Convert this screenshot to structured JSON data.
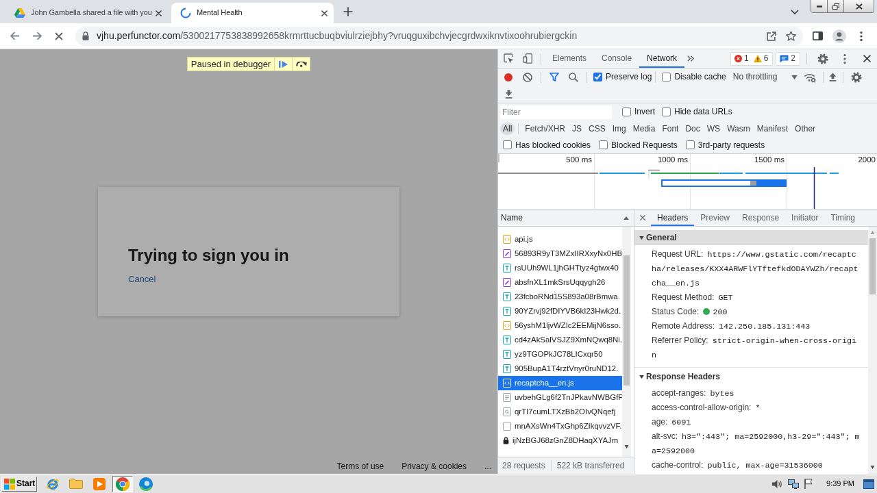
{
  "browser": {
    "tabs": [
      {
        "title": "John Gambella shared a file with you",
        "selected": false,
        "loading": false
      },
      {
        "title": "Mental Health",
        "selected": true,
        "loading": true
      }
    ],
    "address": {
      "host": "vjhu.perfunctor.com",
      "path": "/5300217753838992658krmrttucbuqbviulrziejbhy?vruqguxibchvjecgrdwxiknvtixoohrubiergckin"
    }
  },
  "page": {
    "debugger_banner": "Paused in debugger",
    "card": {
      "title": "Trying to sign you in",
      "link": "Cancel"
    },
    "footer_links": [
      "Terms of use",
      "Privacy & cookies",
      "..."
    ]
  },
  "devtools": {
    "tabs": [
      {
        "label": "Elements",
        "selected": false
      },
      {
        "label": "Console",
        "selected": false
      },
      {
        "label": "Network",
        "selected": true
      }
    ],
    "counts": {
      "errors": "1",
      "warnings": "6",
      "messages": "2"
    },
    "toolbar": {
      "recording": true,
      "checkboxes": [
        {
          "label": "Preserve log",
          "checked": true
        },
        {
          "label": "Disable cache",
          "checked": false
        }
      ],
      "throttling": "No throttling"
    },
    "filter": {
      "placeholder": "Filter",
      "checkboxes": [
        {
          "label": "Invert",
          "checked": false
        },
        {
          "label": "Hide data URLs",
          "checked": false
        }
      ]
    },
    "type_filters": [
      {
        "label": "All",
        "selected": true
      },
      {
        "label": "Fetch/XHR",
        "selected": false
      },
      {
        "label": "JS",
        "selected": false
      },
      {
        "label": "CSS",
        "selected": false
      },
      {
        "label": "Img",
        "selected": false
      },
      {
        "label": "Media",
        "selected": false
      },
      {
        "label": "Font",
        "selected": false
      },
      {
        "label": "Doc",
        "selected": false
      },
      {
        "label": "WS",
        "selected": false
      },
      {
        "label": "Wasm",
        "selected": false
      },
      {
        "label": "Manifest",
        "selected": false
      },
      {
        "label": "Other",
        "selected": false
      }
    ],
    "request_filters": [
      {
        "label": "Has blocked cookies",
        "checked": false
      },
      {
        "label": "Blocked Requests",
        "checked": false
      },
      {
        "label": "3rd-party requests",
        "checked": false
      }
    ],
    "overview": {
      "ticks": [
        "500 ms",
        "1000 ms",
        "1500 ms",
        "2000"
      ]
    },
    "requests": {
      "column": "Name",
      "rows": [
        {
          "name": "api.js",
          "kind": "script",
          "selected": false
        },
        {
          "name": "56893R9yT3MZxIIRXxyNx0HB",
          "kind": "stylesheet",
          "selected": false
        },
        {
          "name": "rsUUh9WL1jhGHTtyz4gtwx40",
          "kind": "font",
          "selected": false
        },
        {
          "name": "absfnXL1mkSrsUqqygh26",
          "kind": "stylesheet",
          "selected": false
        },
        {
          "name": "23fcboRNd15S893a08rBmwa.",
          "kind": "font",
          "selected": false
        },
        {
          "name": "90YZrvj92fDIYVB6kI23Hwk2d.",
          "kind": "font",
          "selected": false
        },
        {
          "name": "56yshM1ljvWZIc2EEMijN6sso.",
          "kind": "script",
          "selected": false
        },
        {
          "name": "cd4zAkSalVSJZ9XmNQwq8Ni.",
          "kind": "font",
          "selected": false
        },
        {
          "name": "yz9TGOPkJC78LICxqr50",
          "kind": "font",
          "selected": false
        },
        {
          "name": "905BupA1T4rztVnyr0ruND12.",
          "kind": "font",
          "selected": false
        },
        {
          "name": "recaptcha__en.js",
          "kind": "script",
          "selected": true
        },
        {
          "name": "uvbehGLg6f2TnJPkavNWBGfP",
          "kind": "document",
          "selected": false
        },
        {
          "name": "qrTI7cumLTXzBb2OIvQNqefj",
          "kind": "image",
          "selected": false
        },
        {
          "name": "mnAXsWn4TxGhp6ZIkqvvzVF.",
          "kind": "blank",
          "selected": false
        },
        {
          "name": "ijNzBGJ68zGnZ8DHaqXYAJm",
          "kind": "lock",
          "selected": false
        }
      ],
      "summary": [
        "28 requests",
        "522 kB transferred"
      ]
    },
    "details": {
      "tabs": [
        {
          "label": "Headers",
          "selected": true
        },
        {
          "label": "Preview",
          "selected": false
        },
        {
          "label": "Response",
          "selected": false
        },
        {
          "label": "Initiator",
          "selected": false
        },
        {
          "label": "Timing",
          "selected": false
        }
      ],
      "sections": [
        {
          "title": "General",
          "expanded": true,
          "selected": true,
          "rows": [
            {
              "name": "Request URL:",
              "value": "https://www.gstatic.com/recaptcha/releases/KXX4ARWFlYTftefkdODAYWZh/recaptcha__en.js"
            },
            {
              "name": "Request Method:",
              "value": "GET"
            },
            {
              "name": "Status Code:",
              "value": "200",
              "color": "#34a853"
            },
            {
              "name": "Remote Address:",
              "value": "142.250.185.131:443"
            },
            {
              "name": "Referrer Policy:",
              "value": "strict-origin-when-cross-origin"
            }
          ]
        },
        {
          "title": "Response Headers",
          "expanded": true,
          "selected": false,
          "rows": [
            {
              "name": "accept-ranges:",
              "value": "bytes"
            },
            {
              "name": "access-control-allow-origin:",
              "value": "*"
            },
            {
              "name": "age:",
              "value": "6091"
            },
            {
              "name": "alt-svc:",
              "value": "h3=\":443\"; ma=2592000,h3-29=\":443\"; ma=2592000"
            },
            {
              "name": "cache-control:",
              "value": "public, max-age=31536000"
            }
          ]
        }
      ]
    }
  },
  "taskbar": {
    "start": "Start",
    "apps": [
      {
        "kind": "ie",
        "selected": false
      },
      {
        "kind": "folder",
        "selected": false
      },
      {
        "kind": "media",
        "selected": false
      },
      {
        "kind": "chrome",
        "selected": true
      },
      {
        "kind": "edge",
        "selected": false
      }
    ],
    "clock": "9:39 PM"
  }
}
